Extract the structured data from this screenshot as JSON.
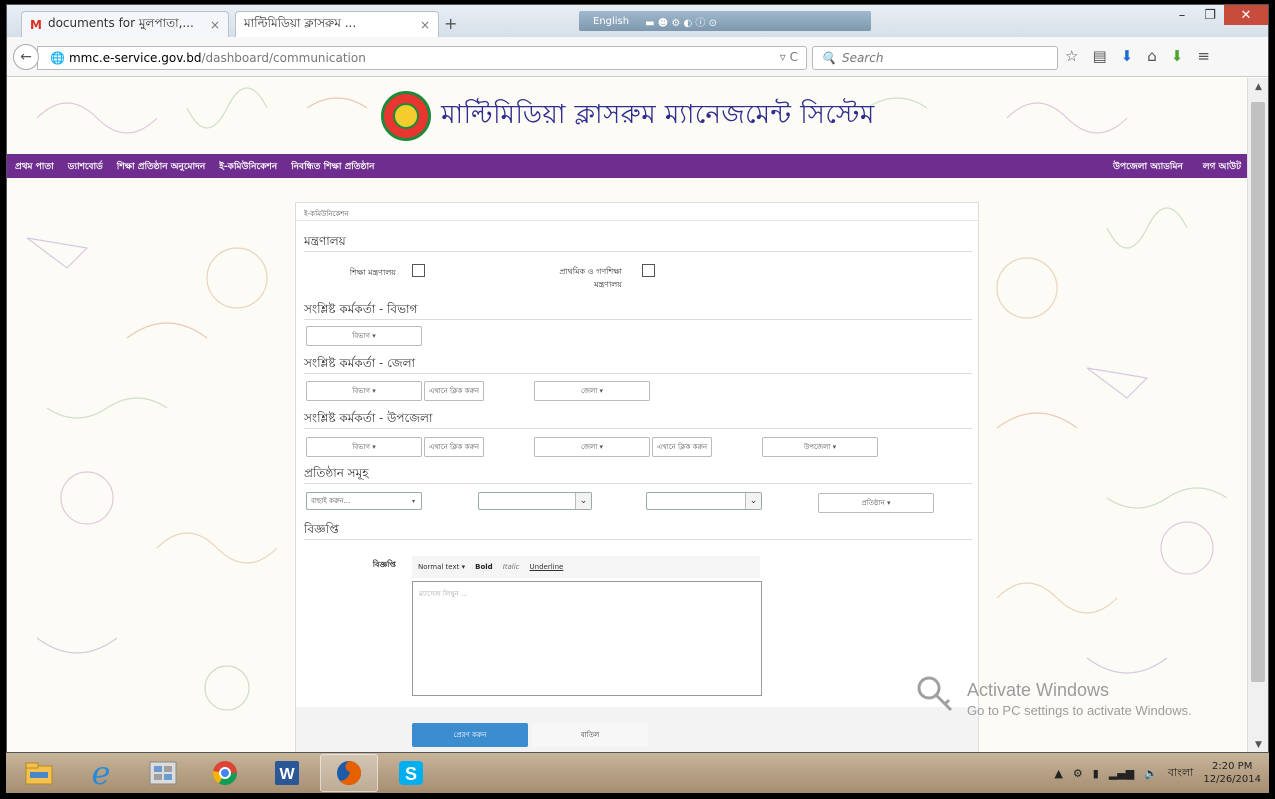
{
  "browser": {
    "tabs": [
      {
        "label": "documents for মুলপাতা,...",
        "icon": "gmail-icon"
      },
      {
        "label": "মাল্টিমিডিয়া ক্লাসরুম ...",
        "icon": "none"
      }
    ],
    "lang_label": "English",
    "url_host": "mmc.e-service.gov.bd",
    "url_path": "/dashboard/communication",
    "search_placeholder": "Search"
  },
  "site": {
    "title": "মাল্টিমিডিয়া ক্লাসরুম ম্যানেজমেন্ট সিস্টেম",
    "menu_left": [
      "প্রথম পাতা",
      "ড্যাশবোর্ড",
      "শিক্ষা প্রতিষ্ঠান অনুমোদন",
      "ই-কমিউনিকেশন",
      "নিবন্ধিত শিক্ষা প্রতিষ্ঠান"
    ],
    "menu_right": [
      "উপজেলা অ্যাডমিন",
      "লগ আউট"
    ]
  },
  "form": {
    "panel_title": "ই-কমিউনিকেশন",
    "ministry_heading": "মন্ত্রণালয়",
    "ministry_opt1": "শিক্ষা মন্ত্রণালয়",
    "ministry_opt2_line1": "প্রাথমিক ও গণশিক্ষা",
    "ministry_opt2_line2": "মন্ত্রণালয়",
    "division_heading": "সংশ্লিষ্ট কর্মকর্তা - বিভাগ",
    "district_heading": "সংশ্লিষ্ট কর্মকর্তা - জেলা",
    "upazila_heading": "সংশ্লিষ্ট কর্মকর্তা - উপজেলা",
    "institution_heading": "প্রতিষ্ঠান সমূহ",
    "notice_heading": "বিজ্ঞপ্তি",
    "division_btn": "বিভাগ",
    "district_btn": "জেলা",
    "upazila_btn": "উপজেলা",
    "click_here": "এখানে ক্লিক করুন",
    "select_placeholder": "বাছাই করুন...",
    "institution_btn": "প্রতিষ্ঠান",
    "notice_label": "বিজ্ঞপ্তি",
    "editor_format": "Normal text",
    "editor_bold": "Bold",
    "editor_italic": "Italic",
    "editor_underline": "Underline",
    "editor_placeholder": "ম্যাসেজ লিখুন ...",
    "submit_label": "প্রেরণ করুন",
    "cancel_label": "বাতিল"
  },
  "watermark": {
    "line1": "Activate Windows",
    "line2": "Go to PC settings to activate Windows."
  },
  "taskbar": {
    "items": [
      "file-explorer-icon",
      "internet-explorer-icon",
      "photo-app-icon",
      "chrome-icon",
      "word-icon",
      "firefox-icon",
      "skype-icon"
    ],
    "lang": "বাংলা",
    "time": "2:20 PM",
    "date": "12/26/2014"
  }
}
